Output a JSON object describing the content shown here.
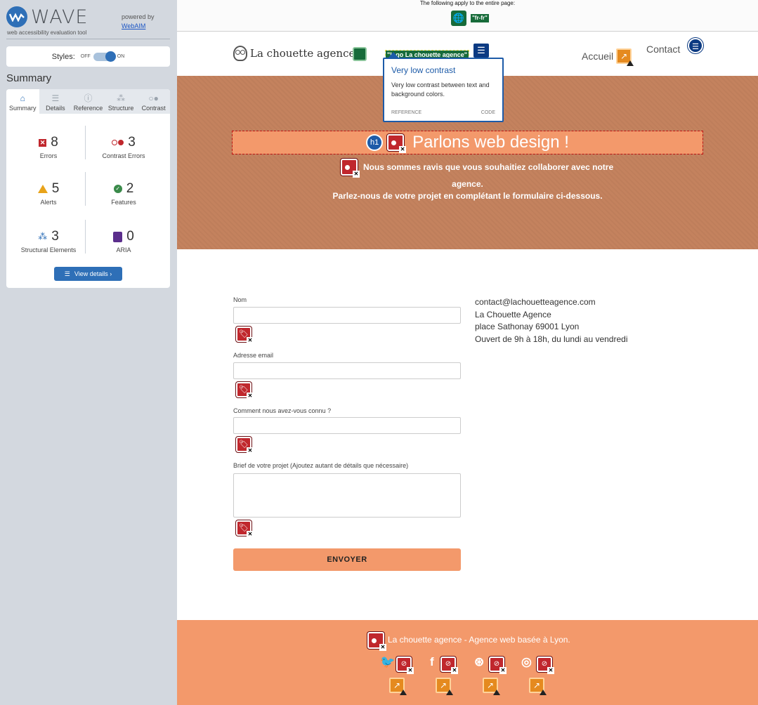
{
  "wave": {
    "title": "WAVE",
    "subtitle": "web accessibility evaluation tool",
    "powered_by": "powered by",
    "webaim_link": "WebAIM",
    "styles_label": "Styles:",
    "toggle_off": "OFF",
    "toggle_on": "ON",
    "summary_heading": "Summary",
    "tabs": [
      {
        "label": "Summary",
        "icon": "home-icon"
      },
      {
        "label": "Details",
        "icon": "list-icon"
      },
      {
        "label": "Reference",
        "icon": "info-icon"
      },
      {
        "label": "Structure",
        "icon": "structure-icon"
      },
      {
        "label": "Contrast",
        "icon": "contrast-icon"
      }
    ],
    "stats": {
      "errors": {
        "count": "8",
        "label": "Errors"
      },
      "contrast_errors": {
        "count": "3",
        "label": "Contrast Errors"
      },
      "alerts": {
        "count": "5",
        "label": "Alerts"
      },
      "features": {
        "count": "2",
        "label": "Features"
      },
      "structural": {
        "count": "3",
        "label": "Structural Elements"
      },
      "aria": {
        "count": "0",
        "label": "ARIA"
      }
    },
    "view_details": "View details ›",
    "colors": {
      "accent": "#2e6fb7",
      "error": "#c0272d",
      "alert": "#e8a31a",
      "feature": "#3a8a4a",
      "aria": "#5b2e8c"
    }
  },
  "page": {
    "topbar_text": "The following apply to the entire page:",
    "lang_tag": "\"fr-fr\"",
    "brand": "La chouette agence",
    "logo_alt": "\"logo La chouette agence\"",
    "nav": {
      "accueil": "Accueil",
      "contact": "Contact"
    },
    "tooltip": {
      "title": "Very low contrast",
      "desc": "Very low contrast between text and background colors.",
      "reference": "REFERENCE",
      "code": "CODE"
    },
    "hero": {
      "h1_badge": "h1",
      "h1": "Parlons web design !",
      "p1": "Nous sommes ravis que vous souhaitiez collaborer avec notre",
      "p1b": "agence.",
      "p2": "Parlez-nous de votre projet en complétant le formulaire ci-dessous."
    },
    "form": {
      "name_label": "Nom",
      "email_label": "Adresse email",
      "source_label": "Comment nous avez-vous connu ?",
      "brief_label": "Brief de votre projet (Ajoutez autant de détails que nécessaire)",
      "submit": "ENVOYER"
    },
    "contact": {
      "email": "contact@lachouetteagence.com",
      "name": "La Chouette Agence",
      "address": "place Sathonay 69001 Lyon",
      "hours": "Ouvert de 9h à 18h, du lundi au vendredi"
    },
    "footer": {
      "text": "La chouette agence - Agence web basée à Lyon."
    },
    "colors": {
      "hero_bg": "#c4825e",
      "accent_orange": "#f3996b",
      "wave_green": "#176b3a",
      "wave_blue": "#0b3a82"
    }
  }
}
